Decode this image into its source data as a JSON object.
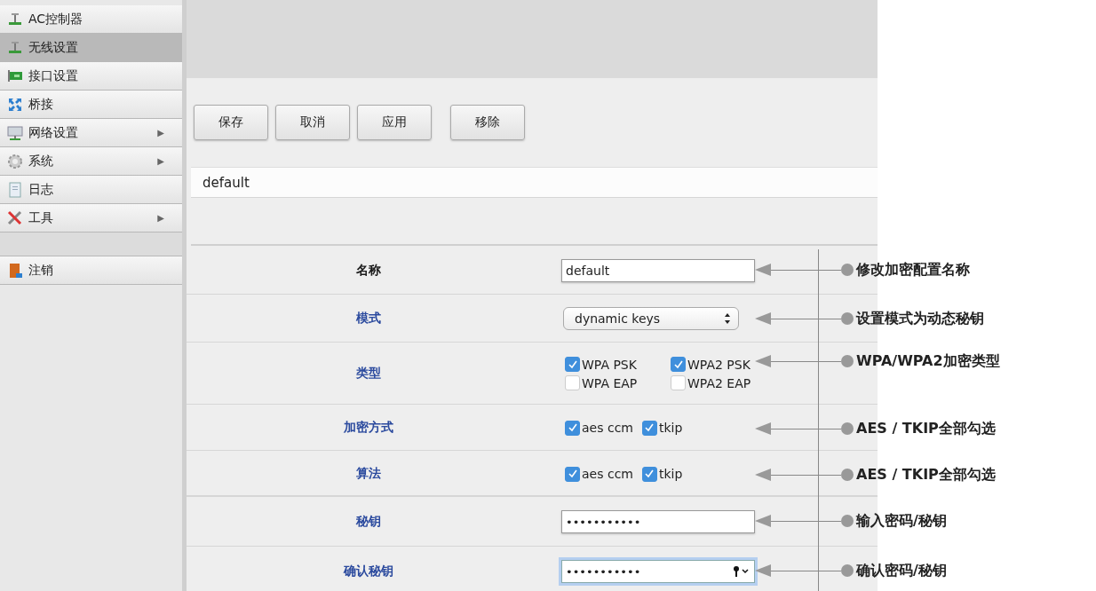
{
  "sidebar": {
    "sections": [
      {
        "items": [
          {
            "label": "AC控制器",
            "selected": false
          },
          {
            "label": "无线设置",
            "selected": true
          },
          {
            "label": "接口设置",
            "selected": false
          },
          {
            "label": "桥接",
            "selected": false
          },
          {
            "label": "网络设置",
            "selected": false,
            "arrow": "▶"
          },
          {
            "label": "系统",
            "selected": false,
            "arrow": "▶"
          },
          {
            "label": "日志",
            "selected": false
          },
          {
            "label": "工具",
            "selected": false,
            "arrow": "▶"
          }
        ]
      },
      {
        "items": [
          {
            "label": "注销",
            "selected": false
          }
        ]
      }
    ]
  },
  "toolbar": {
    "groups": [
      {
        "buttons": [
          "保存",
          "取消",
          "应用"
        ]
      },
      {
        "buttons": [
          "移除"
        ]
      }
    ]
  },
  "profile_bar": {
    "value": "default"
  },
  "form": {
    "rows": [
      {
        "label": "名称",
        "color": "#1a1a1a",
        "kind": "text",
        "value": "default",
        "callout": "修改加密配置名称"
      },
      {
        "label": "模式",
        "color": "#2b4a9e",
        "kind": "select",
        "value": "dynamic keys",
        "callout": "设置模式为动态秘钥"
      },
      {
        "label": "类型",
        "color": "#2b4a9e",
        "kind": "checkboxes",
        "options": [
          {
            "label": "WPA PSK",
            "checked": true
          },
          {
            "label": "WPA2 PSK",
            "checked": true
          },
          {
            "label": "WPA EAP",
            "checked": false
          },
          {
            "label": "WPA2 EAP",
            "checked": false
          }
        ],
        "callout": "WPA/WPA2加密类型"
      },
      {
        "label": "加密方式",
        "color": "#2b4a9e",
        "kind": "checkboxes",
        "options": [
          {
            "label": "aes ccm",
            "checked": true
          },
          {
            "label": "tkip",
            "checked": true
          }
        ],
        "callout": "AES / TKIP全部勾选"
      },
      {
        "label": "算法",
        "color": "#2b4a9e",
        "kind": "checkboxes",
        "options": [
          {
            "label": "aes ccm",
            "checked": true
          },
          {
            "label": "tkip",
            "checked": true
          }
        ],
        "callout": "AES / TKIP全部勾选"
      },
      {
        "label": "秘钥",
        "color": "#2b4a9e",
        "kind": "password",
        "value": "•••••••••••",
        "focused": false,
        "callout": "输入密码/秘钥"
      },
      {
        "label": "确认秘钥",
        "color": "#2b4a9e",
        "kind": "password",
        "value": "•••••••••••",
        "focused": true,
        "callout": "确认密码/秘钥"
      }
    ]
  }
}
